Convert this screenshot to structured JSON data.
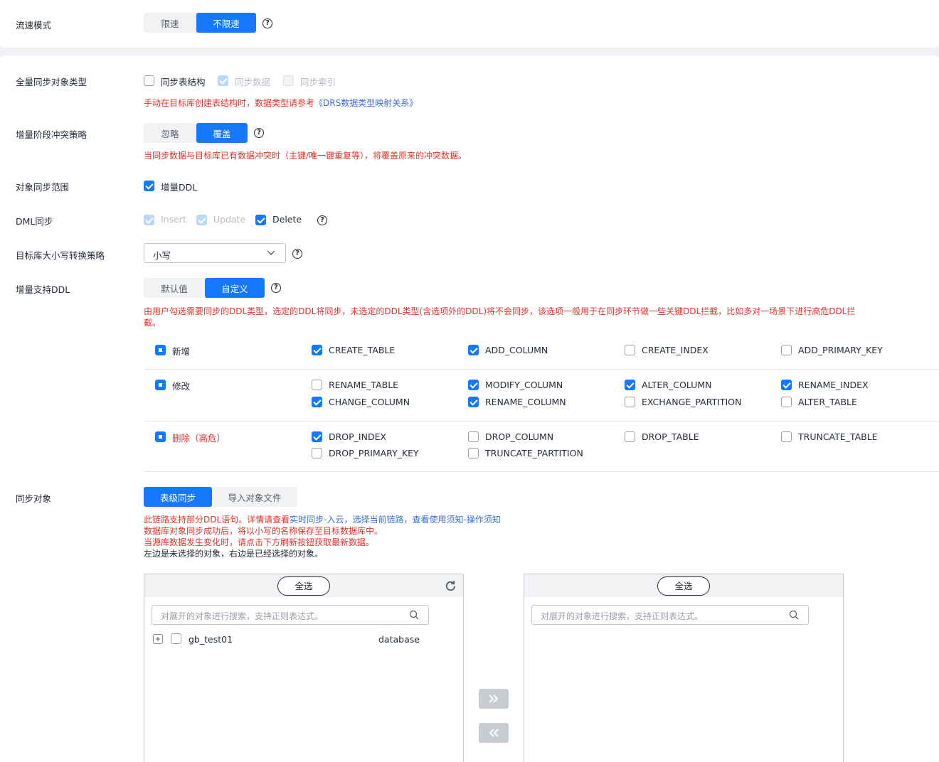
{
  "flow_mode": {
    "label": "流速模式",
    "options": [
      "限速",
      "不限速"
    ],
    "selected": "不限速"
  },
  "full_sync_type": {
    "label": "全量同步对象类型",
    "options": [
      {
        "label": "同步表结构",
        "checked": false,
        "disabled": false
      },
      {
        "label": "同步数据",
        "checked": true,
        "disabled": true
      },
      {
        "label": "同步索引",
        "checked": false,
        "disabled": true
      }
    ],
    "note_prefix": "手动在目标库创建表结构时，数据类型请参考",
    "note_link": "《DRS数据类型映射关系》"
  },
  "conflict_policy": {
    "label": "增量阶段冲突策略",
    "options": [
      "忽略",
      "覆盖"
    ],
    "selected": "覆盖",
    "note": "当同步数据与目标库已有数据冲突时（主键/唯一键重复等），将覆盖原来的冲突数据。"
  },
  "sync_scope": {
    "label": "对象同步范围",
    "option": "增量DDL",
    "checked": true
  },
  "dml_sync": {
    "label": "DML同步",
    "options": [
      {
        "label": "Insert",
        "checked": true,
        "disabled": true
      },
      {
        "label": "Update",
        "checked": true,
        "disabled": true
      },
      {
        "label": "Delete",
        "checked": true,
        "disabled": false
      }
    ]
  },
  "case_policy": {
    "label": "目标库大小写转换策略",
    "value": "小写"
  },
  "ddl_support": {
    "label": "增量支持DDL",
    "options": [
      "默认值",
      "自定义"
    ],
    "selected": "自定义",
    "note_line1": "由用户勾选需要同步的DDL类型，选定的DDL将同步，未选定的DDL类型(含选项外的DDL)将不会同步，该选项一般用于在同步环节做一些关键DDL拦截，比如多对一场景下进行高危DDL拦",
    "note_line2": "截。",
    "groups": [
      {
        "name": "新增",
        "items": [
          {
            "label": "CREATE_TABLE",
            "checked": true
          },
          {
            "label": "ADD_COLUMN",
            "checked": true
          },
          {
            "label": "CREATE_INDEX",
            "checked": false
          },
          {
            "label": "ADD_PRIMARY_KEY",
            "checked": false
          }
        ]
      },
      {
        "name": "修改",
        "items": [
          {
            "label": "RENAME_TABLE",
            "checked": false
          },
          {
            "label": "MODIFY_COLUMN",
            "checked": true
          },
          {
            "label": "ALTER_COLUMN",
            "checked": true
          },
          {
            "label": "RENAME_INDEX",
            "checked": true
          },
          {
            "label": "CHANGE_COLUMN",
            "checked": true
          },
          {
            "label": "RENAME_COLUMN",
            "checked": true
          },
          {
            "label": "EXCHANGE_PARTITION",
            "checked": false
          },
          {
            "label": "ALTER_TABLE",
            "checked": false
          }
        ]
      },
      {
        "name": "删除（高危）",
        "items": [
          {
            "label": "DROP_INDEX",
            "checked": true
          },
          {
            "label": "DROP_COLUMN",
            "checked": false
          },
          {
            "label": "DROP_TABLE",
            "checked": false
          },
          {
            "label": "TRUNCATE_TABLE",
            "checked": false
          },
          {
            "label": "DROP_PRIMARY_KEY",
            "checked": false
          },
          {
            "label": "TRUNCATE_PARTITION",
            "checked": false
          }
        ]
      }
    ]
  },
  "sync_objects": {
    "label": "同步对象",
    "tabs": [
      "表级同步",
      "导入对象文件"
    ],
    "selected_tab": "表级同步",
    "note1_red": "此链路支持部分DDL语句。详情请查看",
    "note1_link": "实时同步-入云，选择当前链路，查看使用须知-操作须知",
    "note2": "数据库对象同步成功后，将以小写的名称保存至目标数据库中。",
    "note3": "当源库数据发生变化时，请点击下方刷新按钮获取最新数据。",
    "note4": "左边是未选择的对象，右边是已经选择的对象。",
    "left": {
      "select_all": "全选",
      "search_placeholder": "对展开的对象进行搜索，支持正则表达式。",
      "rows": [
        {
          "name": "gb_test01",
          "type": "database"
        }
      ]
    },
    "right": {
      "select_all": "全选",
      "search_placeholder": "对展开的对象进行搜索，支持正则表达式。"
    }
  },
  "icons": {
    "help": "question-circle-icon",
    "refresh": "refresh-icon",
    "search": "search-icon",
    "chevron": "chevron-down-icon",
    "expand": "plus-square-icon",
    "move_right": "double-chevron-right-icon",
    "move_left": "double-chevron-left-icon"
  },
  "colors": {
    "primary": "#1677ff",
    "danger": "#e8312a",
    "link": "#3a6ed5"
  }
}
